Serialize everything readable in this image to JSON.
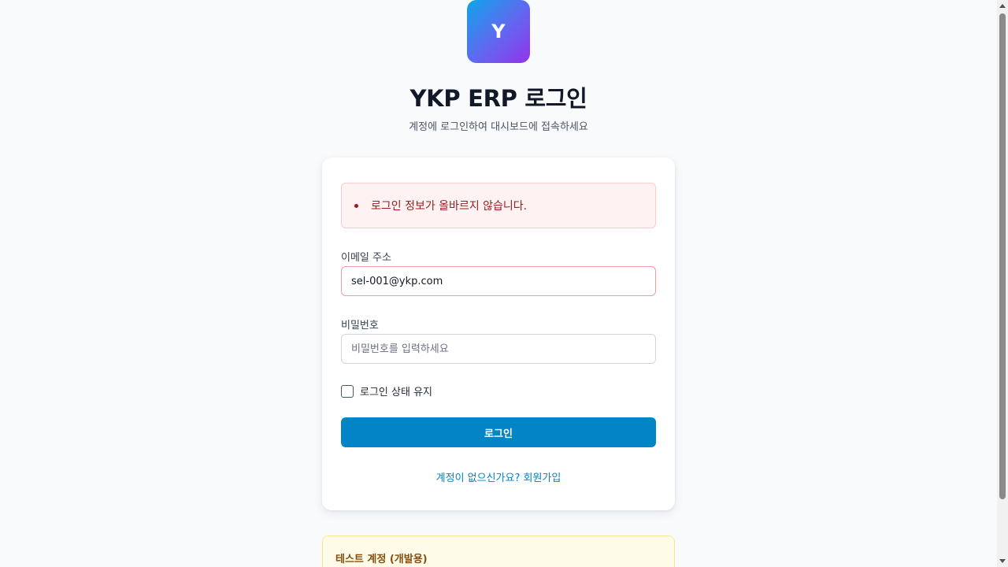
{
  "logo": {
    "letter": "Y"
  },
  "header": {
    "title": "YKP ERP 로그인",
    "subtitle": "계정에 로그인하여 대시보드에 접속하세요"
  },
  "alert": {
    "message": "로그인 정보가 올바르지 않습니다."
  },
  "form": {
    "email_label": "이메일 주소",
    "email_value": "sel-001@ykp.com",
    "password_label": "비밀번호",
    "password_placeholder": "비밀번호를 입력하세요",
    "remember_label": "로그인 상태 유지",
    "remember_checked": false,
    "submit_label": "로그인"
  },
  "signup_link": "계정이 없으신가요? 회원가입",
  "test_accounts": {
    "title": "테스트 계정 (개발용)"
  },
  "colors": {
    "primary": "#0284c7",
    "error_text": "#991b1b",
    "error_bg": "#fef2f2",
    "warning_bg": "#fefce8"
  }
}
